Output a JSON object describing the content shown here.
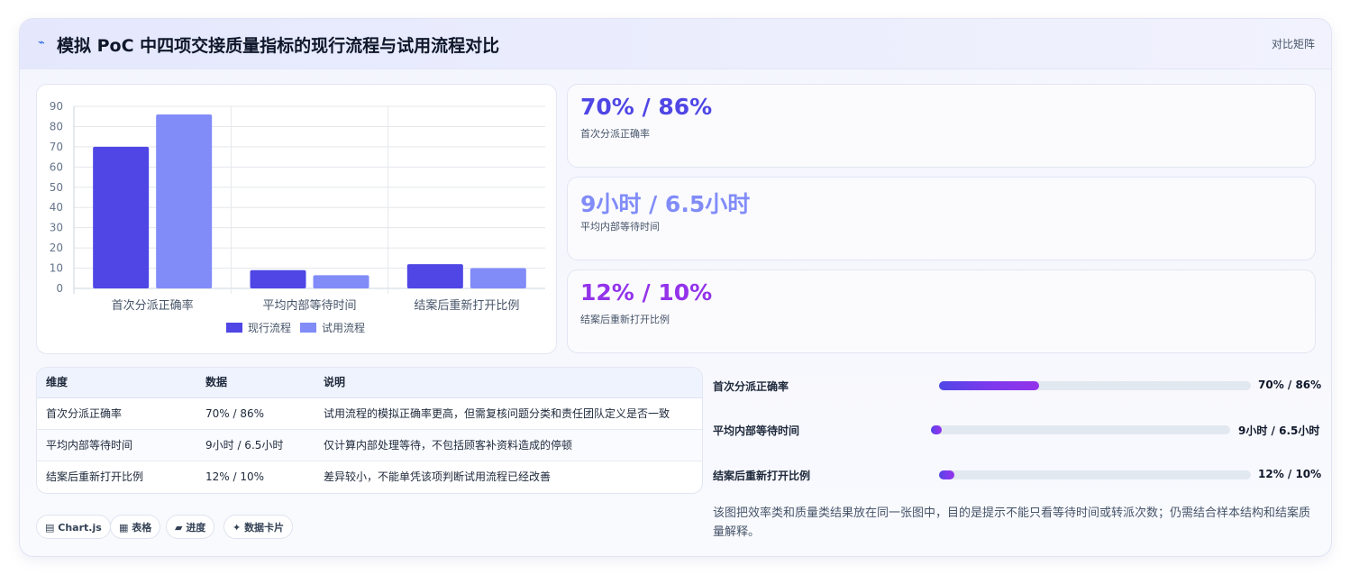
{
  "header": {
    "icon": "pulse-icon",
    "title": "模拟 PoC 中四项交接质量指标的现行流程与试用流程对比",
    "mode_label": "对比矩阵"
  },
  "colors": {
    "current": "#4f46e5",
    "trial": "#818cf8",
    "accent_purple": "#9333ea",
    "kpi1": "#4f46e5",
    "kpi2": "#818cf8",
    "kpi3": "#9333ea"
  },
  "chart_data": {
    "type": "bar",
    "categories": [
      "首次分派正确率",
      "平均内部等待时间",
      "结案后重新打开比例"
    ],
    "series": [
      {
        "name": "现行流程",
        "values": [
          70,
          9,
          12
        ]
      },
      {
        "name": "试用流程",
        "values": [
          86,
          6.5,
          10
        ]
      }
    ],
    "ylim": [
      0,
      90
    ],
    "yticks": [
      0,
      10,
      20,
      30,
      40,
      50,
      60,
      70,
      80,
      90
    ],
    "grid": true,
    "legend_position": "bottom",
    "title": "",
    "xlabel": "",
    "ylabel": ""
  },
  "kpis": [
    {
      "value": "70% / 86%",
      "label": "首次分派正确率"
    },
    {
      "value": "9小时 / 6.5小时",
      "label": "平均内部等待时间"
    },
    {
      "value": "12% / 10%",
      "label": "结案后重新打开比例"
    }
  ],
  "table": {
    "headers": [
      "维度",
      "数据",
      "说明"
    ],
    "rows": [
      [
        "首次分派正确率",
        "70% / 86%",
        "试用流程的模拟正确率更高，但需复核问题分类和责任团队定义是否一致"
      ],
      [
        "平均内部等待时间",
        "9小时 / 6.5小时",
        "仅计算内部处理等待，不包括顾客补资料造成的停顿"
      ],
      [
        "结案后重新打开比例",
        "12% / 10%",
        "差异较小，不能单凭该项判断试用流程已经改善"
      ]
    ]
  },
  "progress": [
    {
      "label": "首次分派正确率",
      "value_text": "70% / 86%",
      "fraction": 0.32
    },
    {
      "label": "平均内部等待时间",
      "value_text": "9小时 / 6.5小时",
      "fraction": 0.035
    },
    {
      "label": "结案后重新打开比例",
      "value_text": "12% / 10%",
      "fraction": 0.05
    }
  ],
  "note": "该图把效率类和质量类结果放在同一张图中，目的是提示不能只看等待时间或转派次数；仍需结合样本结构和结案质量解释。",
  "chips": [
    {
      "icon": "chart-icon",
      "glyph": "▤",
      "label": "Chart.js"
    },
    {
      "icon": "table-icon",
      "glyph": "▦",
      "label": "表格"
    },
    {
      "icon": "progress-icon",
      "glyph": "▰",
      "label": "进度"
    },
    {
      "icon": "sparkle-icon",
      "glyph": "✦",
      "label": "数据卡片"
    }
  ]
}
